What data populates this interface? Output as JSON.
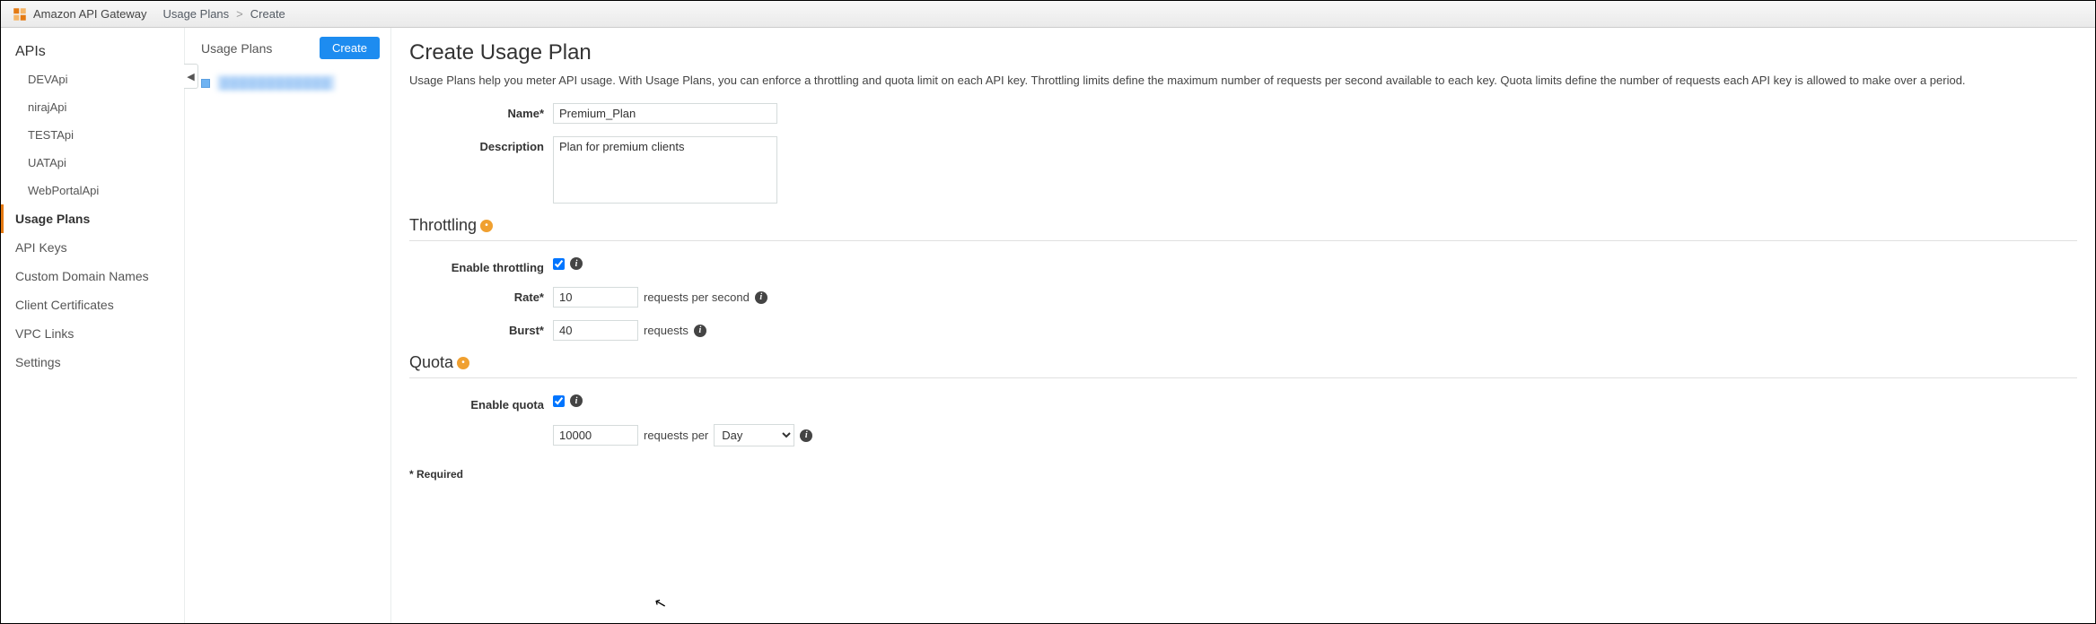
{
  "topbar": {
    "service": "Amazon API Gateway",
    "crumb1": "Usage Plans",
    "crumb2": "Create"
  },
  "sidebar": {
    "heading": "APIs",
    "apis": [
      "DEVApi",
      "nirajApi",
      "TESTApi",
      "UATApi",
      "WebPortalApi"
    ],
    "items": [
      "Usage Plans",
      "API Keys",
      "Custom Domain Names",
      "Client Certificates",
      "VPC Links",
      "Settings"
    ],
    "active_index": 0
  },
  "midcol": {
    "title": "Usage Plans",
    "create_label": "Create",
    "existing_plan": "▒▒▒▒▒▒▒▒▒▒▒▒"
  },
  "main": {
    "title": "Create Usage Plan",
    "description": "Usage Plans help you meter API usage. With Usage Plans, you can enforce a throttling and quota limit on each API key. Throttling limits define the maximum number of requests per second available to each key. Quota limits define the number of requests each API key is allowed to make over a period.",
    "name_label": "Name*",
    "name_value": "Premium_Plan",
    "desc_label": "Description",
    "desc_value": "Plan for premium clients",
    "throttling": {
      "heading": "Throttling",
      "enable_label": "Enable throttling",
      "enable_checked": true,
      "rate_label": "Rate*",
      "rate_value": "10",
      "rate_unit": "requests per second",
      "burst_label": "Burst*",
      "burst_value": "40",
      "burst_unit": "requests"
    },
    "quota": {
      "heading": "Quota",
      "enable_label": "Enable quota",
      "enable_checked": true,
      "count_value": "10000",
      "per_label": "requests per",
      "period_value": "Day"
    },
    "required_note": "* Required"
  }
}
